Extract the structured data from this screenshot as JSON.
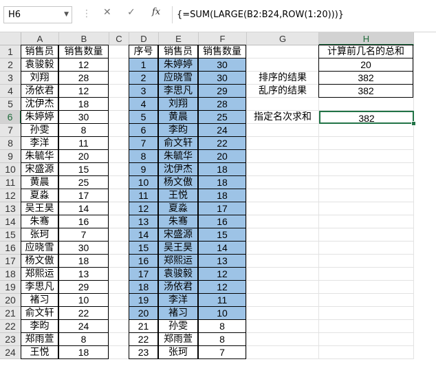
{
  "formula_bar": {
    "name_box": "H6",
    "cancel_icon": "✕",
    "enter_icon": "✓",
    "fx_label": "fx",
    "formula": "{=SUM(LARGE(B2:B24,ROW(1:20)))}"
  },
  "columns": [
    "A",
    "B",
    "C",
    "D",
    "E",
    "F",
    "G",
    "H"
  ],
  "rows": [
    "1",
    "2",
    "3",
    "4",
    "5",
    "6",
    "7",
    "8",
    "9",
    "10",
    "11",
    "12",
    "13",
    "14",
    "15",
    "16",
    "17",
    "18",
    "19",
    "20",
    "21",
    "22",
    "23",
    "24"
  ],
  "table_ab": {
    "headers": [
      "销售员",
      "销售数量"
    ],
    "rows": [
      [
        "袁骏毅",
        "12"
      ],
      [
        "刘翔",
        "28"
      ],
      [
        "汤依君",
        "12"
      ],
      [
        "沈伊杰",
        "18"
      ],
      [
        "朱婷婷",
        "30"
      ],
      [
        "孙雯",
        "8"
      ],
      [
        "李洋",
        "11"
      ],
      [
        "朱毓华",
        "20"
      ],
      [
        "宋盛源",
        "15"
      ],
      [
        "黄晨",
        "25"
      ],
      [
        "夏淼",
        "17"
      ],
      [
        "吴王昊",
        "14"
      ],
      [
        "朱骞",
        "16"
      ],
      [
        "张珂",
        "7"
      ],
      [
        "应晓雪",
        "30"
      ],
      [
        "杨文傲",
        "18"
      ],
      [
        "郑熙运",
        "13"
      ],
      [
        "李思凡",
        "29"
      ],
      [
        "褚习",
        "10"
      ],
      [
        "俞文轩",
        "22"
      ],
      [
        "李昀",
        "24"
      ],
      [
        "郑雨萱",
        "8"
      ],
      [
        "王悦",
        "18"
      ]
    ]
  },
  "table_def": {
    "headers": [
      "序号",
      "销售员",
      "销售数量"
    ],
    "rows": [
      [
        "1",
        "朱婷婷",
        "30"
      ],
      [
        "2",
        "应晓雪",
        "30"
      ],
      [
        "3",
        "李思凡",
        "29"
      ],
      [
        "4",
        "刘翔",
        "28"
      ],
      [
        "5",
        "黄晨",
        "25"
      ],
      [
        "6",
        "李昀",
        "24"
      ],
      [
        "7",
        "俞文轩",
        "22"
      ],
      [
        "8",
        "朱毓华",
        "20"
      ],
      [
        "9",
        "沈伊杰",
        "18"
      ],
      [
        "10",
        "杨文傲",
        "18"
      ],
      [
        "11",
        "王悦",
        "18"
      ],
      [
        "12",
        "夏淼",
        "17"
      ],
      [
        "13",
        "朱骞",
        "16"
      ],
      [
        "14",
        "宋盛源",
        "15"
      ],
      [
        "15",
        "吴王昊",
        "14"
      ],
      [
        "16",
        "郑熙运",
        "13"
      ],
      [
        "17",
        "袁骏毅",
        "12"
      ],
      [
        "18",
        "汤依君",
        "12"
      ],
      [
        "19",
        "李洋",
        "11"
      ],
      [
        "20",
        "褚习",
        "10"
      ],
      [
        "21",
        "孙雯",
        "8"
      ],
      [
        "22",
        "郑雨萱",
        "8"
      ],
      [
        "23",
        "张珂",
        "7"
      ]
    ]
  },
  "summary": {
    "h1_header": "计算前几名的总和",
    "h2_value": "20",
    "g3_label": "排序的结果",
    "h3_value": "382",
    "g4_label": "乱序的结果",
    "h4_value": "382",
    "g6_label": "指定名次求和",
    "h6_value": "382"
  },
  "colors": {
    "highlight_blue": "#9dc3e6",
    "excel_green": "#217346",
    "header_gray": "#e6e6e6"
  }
}
